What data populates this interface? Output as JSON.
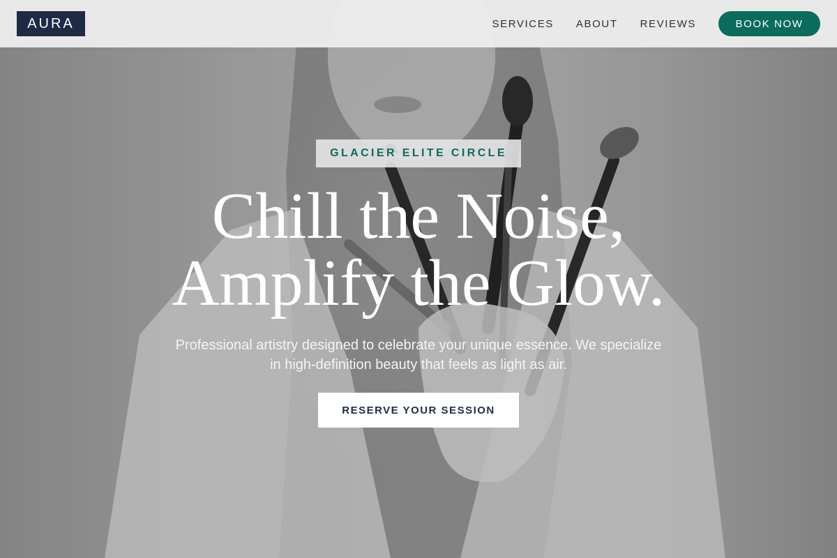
{
  "brand": {
    "logo_text": "AURA"
  },
  "nav": {
    "items": [
      {
        "label": "SERVICES"
      },
      {
        "label": "ABOUT"
      },
      {
        "label": "REVIEWS"
      }
    ],
    "cta_label": "BOOK NOW"
  },
  "hero": {
    "badge": "GLACIER ELITE CIRCLE",
    "headline_line1": "Chill the Noise,",
    "headline_line2": "Amplify the Glow.",
    "description": "Professional artistry designed to celebrate your unique essence. We specialize in high-definition beauty that feels as light as air.",
    "cta_label": "RESERVE YOUR SESSION"
  },
  "colors": {
    "accent": "#0b6b5c",
    "navy": "#1f2a44",
    "header_bg": "#ececec"
  }
}
